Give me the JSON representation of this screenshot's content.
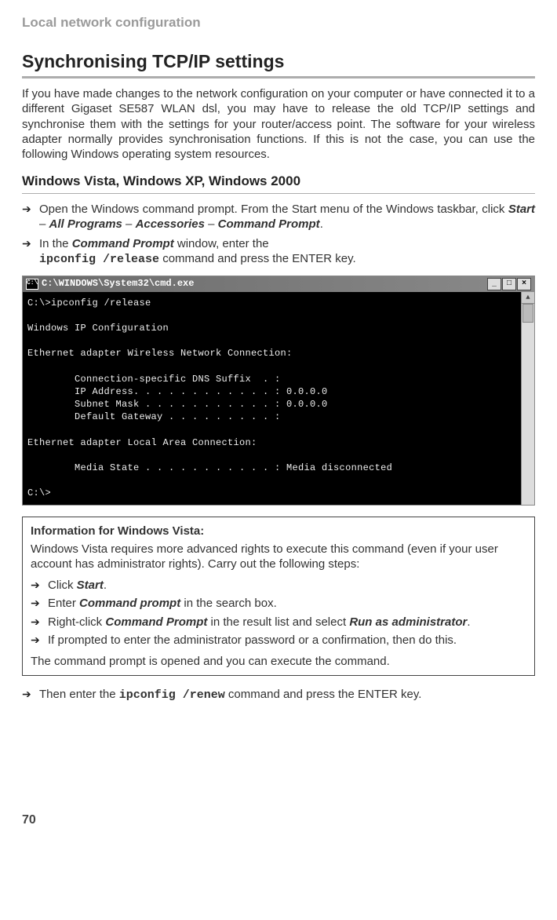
{
  "header": "Local network configuration",
  "section_title": "Synchronising TCP/IP settings",
  "intro": "If you have made changes to the network configuration on your computer or have connected it to a different Gigaset SE587 WLAN dsl, you may have to release the old TCP/IP settings and synchronise them with the settings for your router/access point. The software for your wireless adapter normally provides synchronisation functions. If this is not the case, you can use the following Windows operating system resources.",
  "subsection_title": "Windows Vista, Windows XP, Windows 2000",
  "steps_a": {
    "s1a": "Open the Windows command prompt. From the Start menu of the Windows taskbar, click ",
    "s1b": "Start",
    "s1c": " – ",
    "s1d": "All Programs",
    "s1e": " – ",
    "s1f": "Accessories",
    "s1g": " – ",
    "s1h": "Command Prompt",
    "s1i": ".",
    "s2a": "In the ",
    "s2b": "Command Prompt",
    "s2c": " window, enter the",
    "s2d": "ipconfig /release",
    "s2e": " command and press the ENTER key."
  },
  "cmd": {
    "title": "C:\\WINDOWS\\System32\\cmd.exe",
    "min": "_",
    "max": "□",
    "close": "×",
    "content": "C:\\>ipconfig /release\n\nWindows IP Configuration\n\nEthernet adapter Wireless Network Connection:\n\n        Connection-specific DNS Suffix  . :\n        IP Address. . . . . . . . . . . . : 0.0.0.0\n        Subnet Mask . . . . . . . . . . . : 0.0.0.0\n        Default Gateway . . . . . . . . . :\n\nEthernet adapter Local Area Connection:\n\n        Media State . . . . . . . . . . . : Media disconnected\n\nC:\\>"
  },
  "infobox": {
    "title": "Information for Windows Vista:",
    "intro": "Windows Vista requires more advanced rights to execute this command (even if your user account has administrator rights). Carry out the following steps:",
    "s1a": "Click ",
    "s1b": "Start",
    "s1c": ".",
    "s2a": "Enter ",
    "s2b": "Command prompt",
    "s2c": " in the search box.",
    "s3a": "Right-click ",
    "s3b": "Command Prompt",
    "s3c": " in the result list and select ",
    "s3d": "Run as administrator",
    "s3e": ".",
    "s4": "If prompted to enter the administrator password or a confirmation, then do this.",
    "outro": "The command prompt is opened and you can execute the command."
  },
  "final_step": {
    "a": "Then enter the ",
    "b": "ipconfig /renew",
    "c": " command and press the ENTER key."
  },
  "page_number": "70",
  "arrow": "➦"
}
